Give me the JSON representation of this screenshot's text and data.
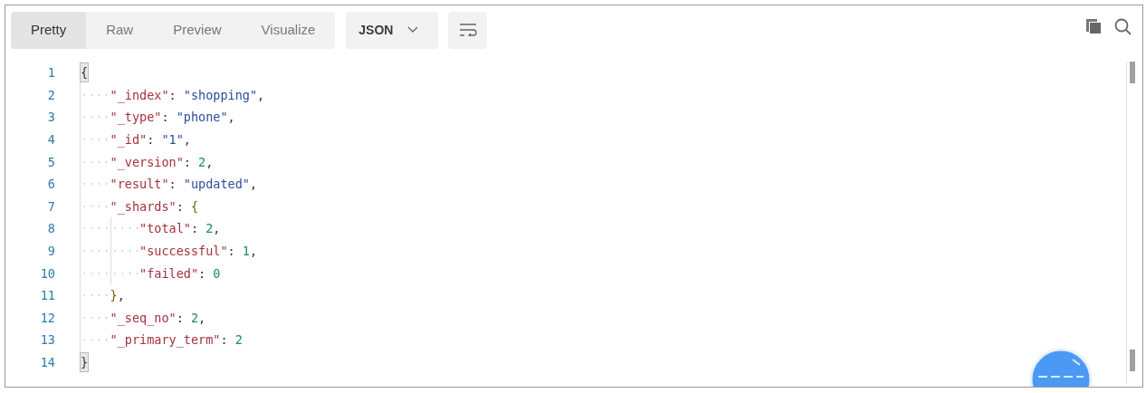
{
  "tabs": [
    {
      "label": "Pretty",
      "selected": true
    },
    {
      "label": "Raw",
      "selected": false
    },
    {
      "label": "Preview",
      "selected": false
    },
    {
      "label": "Visualize",
      "selected": false
    }
  ],
  "format_dropdown": {
    "value": "JSON"
  },
  "code_lines": [
    {
      "number": "1",
      "tokens": [
        {
          "kind": "brace",
          "text": "{",
          "highlighted": true
        }
      ],
      "children": [
        {
          "number": "2",
          "tokens": [
            {
              "kind": "key",
              "text": "\"_index\""
            },
            {
              "kind": "punct",
              "text": ": "
            },
            {
              "kind": "string",
              "text": "\"shopping\""
            },
            {
              "kind": "punct",
              "text": ","
            }
          ]
        },
        {
          "number": "3",
          "tokens": [
            {
              "kind": "key",
              "text": "\"_type\""
            },
            {
              "kind": "punct",
              "text": ": "
            },
            {
              "kind": "string",
              "text": "\"phone\""
            },
            {
              "kind": "punct",
              "text": ","
            }
          ]
        },
        {
          "number": "4",
          "tokens": [
            {
              "kind": "key",
              "text": "\"_id\""
            },
            {
              "kind": "punct",
              "text": ": "
            },
            {
              "kind": "string",
              "text": "\"1\""
            },
            {
              "kind": "punct",
              "text": ","
            }
          ]
        },
        {
          "number": "5",
          "tokens": [
            {
              "kind": "key",
              "text": "\"_version\""
            },
            {
              "kind": "punct",
              "text": ": "
            },
            {
              "kind": "number",
              "text": "2"
            },
            {
              "kind": "punct",
              "text": ","
            }
          ]
        },
        {
          "number": "6",
          "tokens": [
            {
              "kind": "key",
              "text": "\"result\""
            },
            {
              "kind": "punct",
              "text": ": "
            },
            {
              "kind": "string",
              "text": "\"updated\""
            },
            {
              "kind": "punct",
              "text": ","
            }
          ]
        },
        {
          "number": "7",
          "tokens": [
            {
              "kind": "key",
              "text": "\"_shards\""
            },
            {
              "kind": "punct",
              "text": ": "
            },
            {
              "kind": "brace",
              "text": "{",
              "highlighted": false
            }
          ],
          "children": [
            {
              "number": "8",
              "tokens": [
                {
                  "kind": "key",
                  "text": "\"total\""
                },
                {
                  "kind": "punct",
                  "text": ": "
                },
                {
                  "kind": "number",
                  "text": "2"
                },
                {
                  "kind": "punct",
                  "text": ","
                }
              ]
            },
            {
              "number": "9",
              "tokens": [
                {
                  "kind": "key",
                  "text": "\"successful\""
                },
                {
                  "kind": "punct",
                  "text": ": "
                },
                {
                  "kind": "number",
                  "text": "1"
                },
                {
                  "kind": "punct",
                  "text": ","
                }
              ]
            },
            {
              "number": "10",
              "tokens": [
                {
                  "kind": "key",
                  "text": "\"failed\""
                },
                {
                  "kind": "punct",
                  "text": ": "
                },
                {
                  "kind": "number",
                  "text": "0"
                }
              ]
            }
          ]
        },
        {
          "number": "11",
          "tokens": [
            {
              "kind": "brace",
              "text": "}",
              "highlighted": false
            },
            {
              "kind": "punct",
              "text": ","
            }
          ]
        },
        {
          "number": "12",
          "tokens": [
            {
              "kind": "key",
              "text": "\"_seq_no\""
            },
            {
              "kind": "punct",
              "text": ": "
            },
            {
              "kind": "number",
              "text": "2"
            },
            {
              "kind": "punct",
              "text": ","
            }
          ]
        },
        {
          "number": "13",
          "tokens": [
            {
              "kind": "key",
              "text": "\"_primary_term\""
            },
            {
              "kind": "punct",
              "text": ": "
            },
            {
              "kind": "number",
              "text": "2"
            }
          ]
        }
      ]
    },
    {
      "number": "14",
      "tokens": [
        {
          "kind": "brace",
          "text": "}",
          "highlighted": true
        }
      ]
    }
  ]
}
